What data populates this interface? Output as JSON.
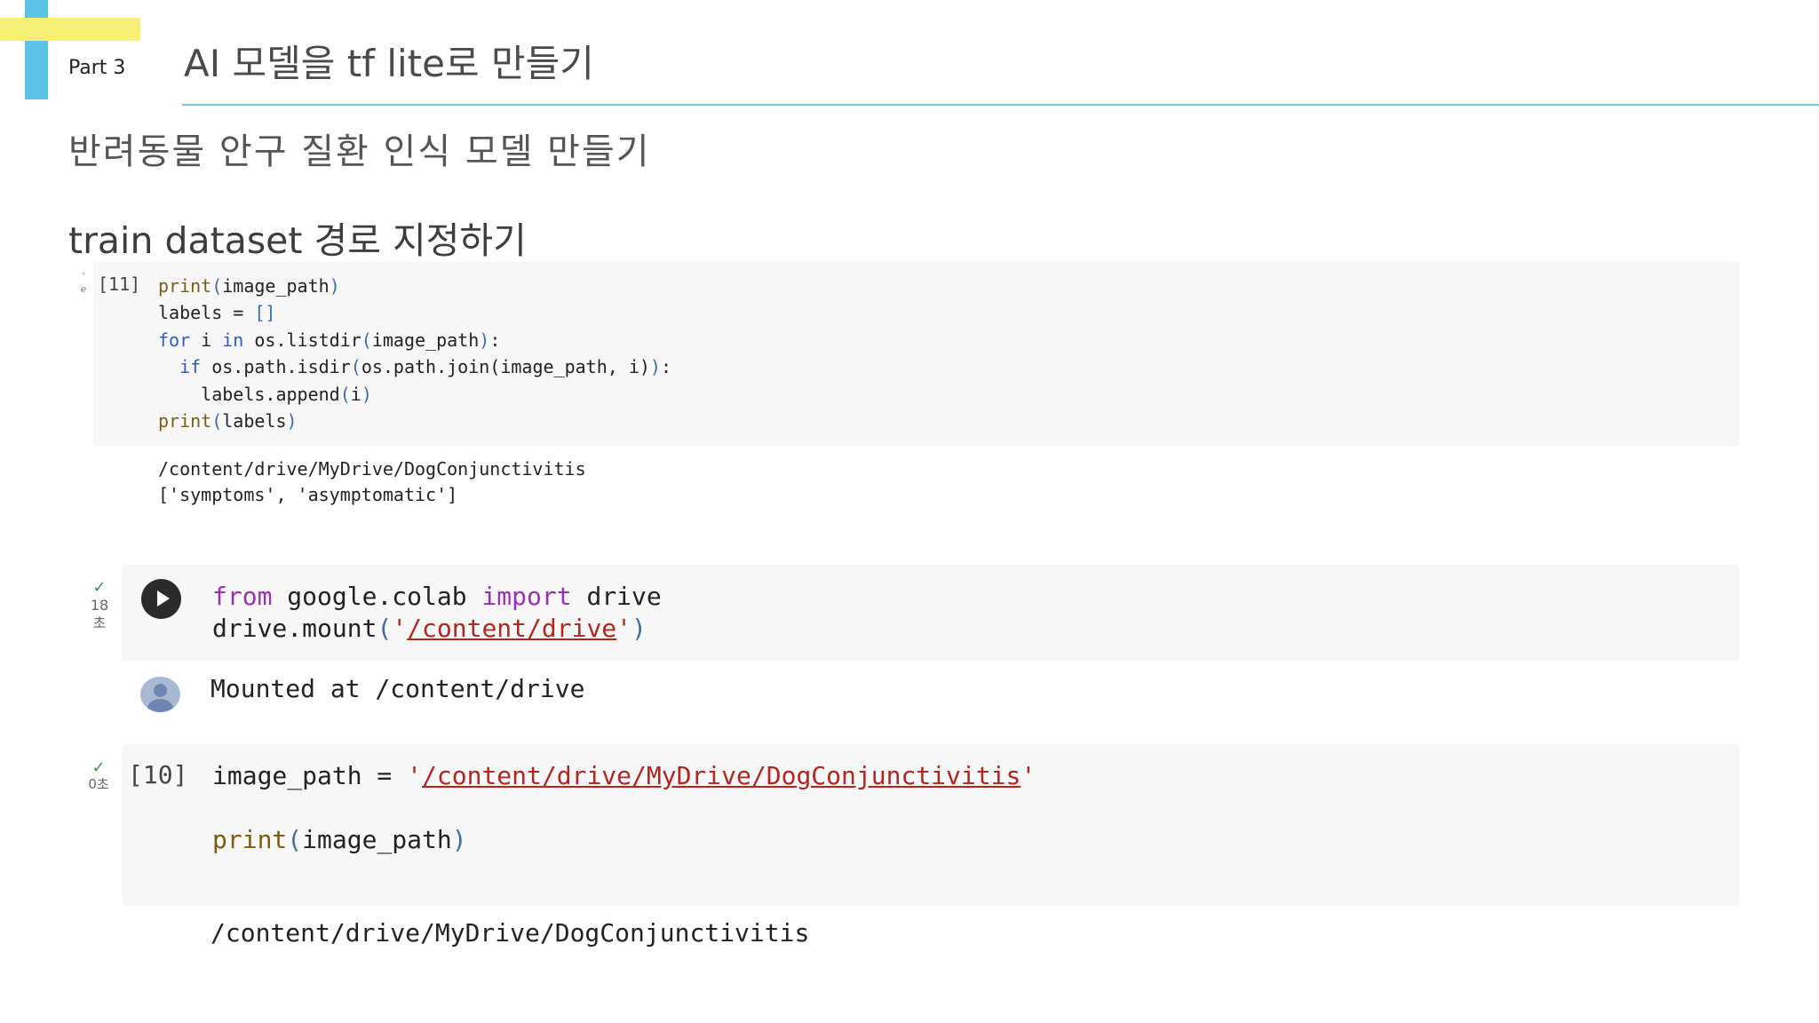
{
  "header": {
    "part_label": "Part 3",
    "title": "AI 모델을 tf lite로 만들기"
  },
  "subtitle": "반려동물 안구 질환 인식 모델 만들기",
  "section_title": "train dataset 경로 지정하기",
  "cell1": {
    "exec_count": "[11]",
    "code": {
      "line1_fn": "print",
      "line1_arg": "image_path",
      "line2": "labels = ",
      "line2_val": "[]",
      "line3_for": "for",
      "line3_i": " i ",
      "line3_in": "in",
      "line3_rest": " os.listdir",
      "line3_arg": "image_path",
      "line4_if": "if",
      "line4_rest": " os.path.isdir",
      "line4_arg": "os.path.join(image_path, i)",
      "line5": "labels.append",
      "line5_arg": "i",
      "line6_fn": "print",
      "line6_arg": "labels"
    },
    "output": [
      "/content/drive/MyDrive/DogConjunctivitis",
      "['symptoms', 'asymptomatic']"
    ]
  },
  "cell2": {
    "status_time": "18",
    "status_unit": "초",
    "code": {
      "from": "from",
      "module": " google.colab ",
      "import": "import",
      "name": " drive",
      "line2_fn": "drive.mount",
      "line2_str": "/content/drive"
    },
    "output": "Mounted at /content/drive"
  },
  "cell3": {
    "status_time": "0초",
    "exec_count": "[10]",
    "code": {
      "line1": "image_path = ",
      "line1_str": "/content/drive/MyDrive/DogConjunctivitis",
      "line2_fn": "print",
      "line2_arg": "image_path"
    },
    "output": "/content/drive/MyDrive/DogConjunctivitis"
  }
}
